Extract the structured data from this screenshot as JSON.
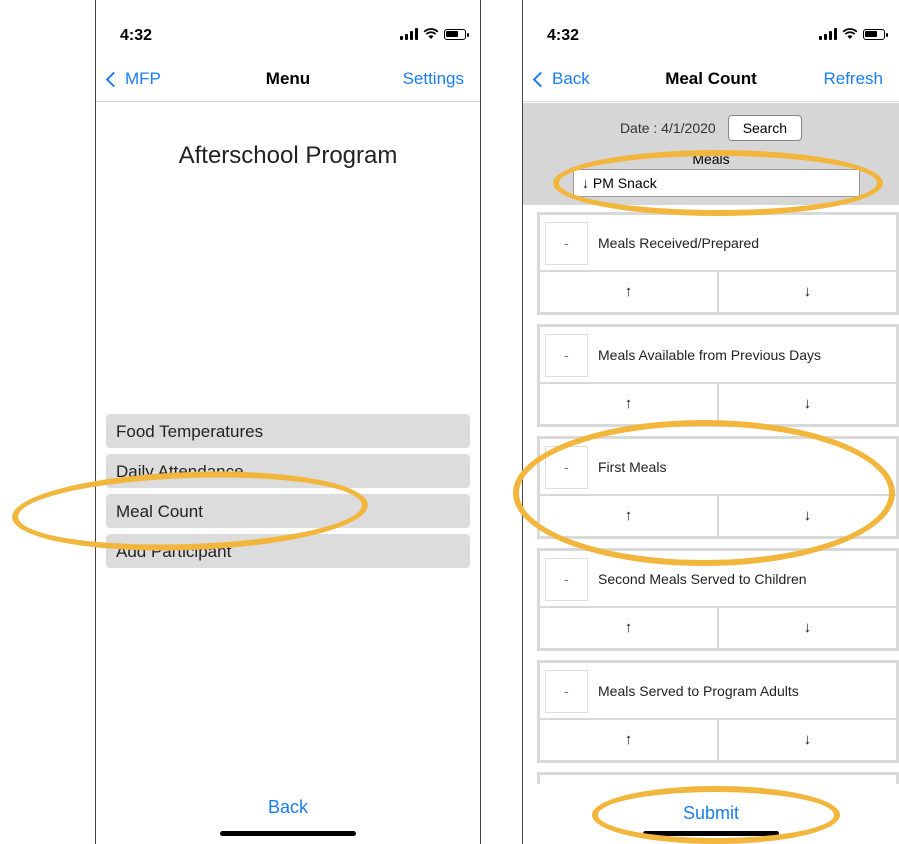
{
  "left_screen": {
    "status": {
      "time": "4:32"
    },
    "nav": {
      "back_label": "MFP",
      "title": "Menu",
      "right_label": "Settings"
    },
    "program_title": "Afterschool Program",
    "menu_items": [
      {
        "label": "Food Temperatures"
      },
      {
        "label": "Daily Attendance"
      },
      {
        "label": "Meal Count"
      },
      {
        "label": "Add Participant"
      }
    ],
    "bottom_label": "Back"
  },
  "right_screen": {
    "status": {
      "time": "4:32"
    },
    "nav": {
      "back_label": "Back",
      "title": "Meal Count",
      "right_label": "Refresh"
    },
    "date_label": "Date : 4/1/2020",
    "search_label": "Search",
    "meals_label": "Meals",
    "meals_selected": "↓ PM Snack",
    "cards": [
      {
        "qty": "-",
        "label": "Meals Received/Prepared",
        "up": "↑",
        "down": "↓"
      },
      {
        "qty": "-",
        "label": "Meals Available from Previous Days",
        "up": "↑",
        "down": "↓"
      },
      {
        "qty": "-",
        "label": "First Meals",
        "up": "↑",
        "down": "↓"
      },
      {
        "qty": "-",
        "label": "Second Meals Served to Children",
        "up": "↑",
        "down": "↓"
      },
      {
        "qty": "-",
        "label": "Meals Served to Program Adults",
        "up": "↑",
        "down": "↓"
      }
    ],
    "submit_label": "Submit"
  },
  "colors": {
    "accent": "#1a7df0",
    "highlight": "#f2b63d",
    "menu_item_bg": "#dcdcdc",
    "filter_bg": "#d6d6d6"
  }
}
